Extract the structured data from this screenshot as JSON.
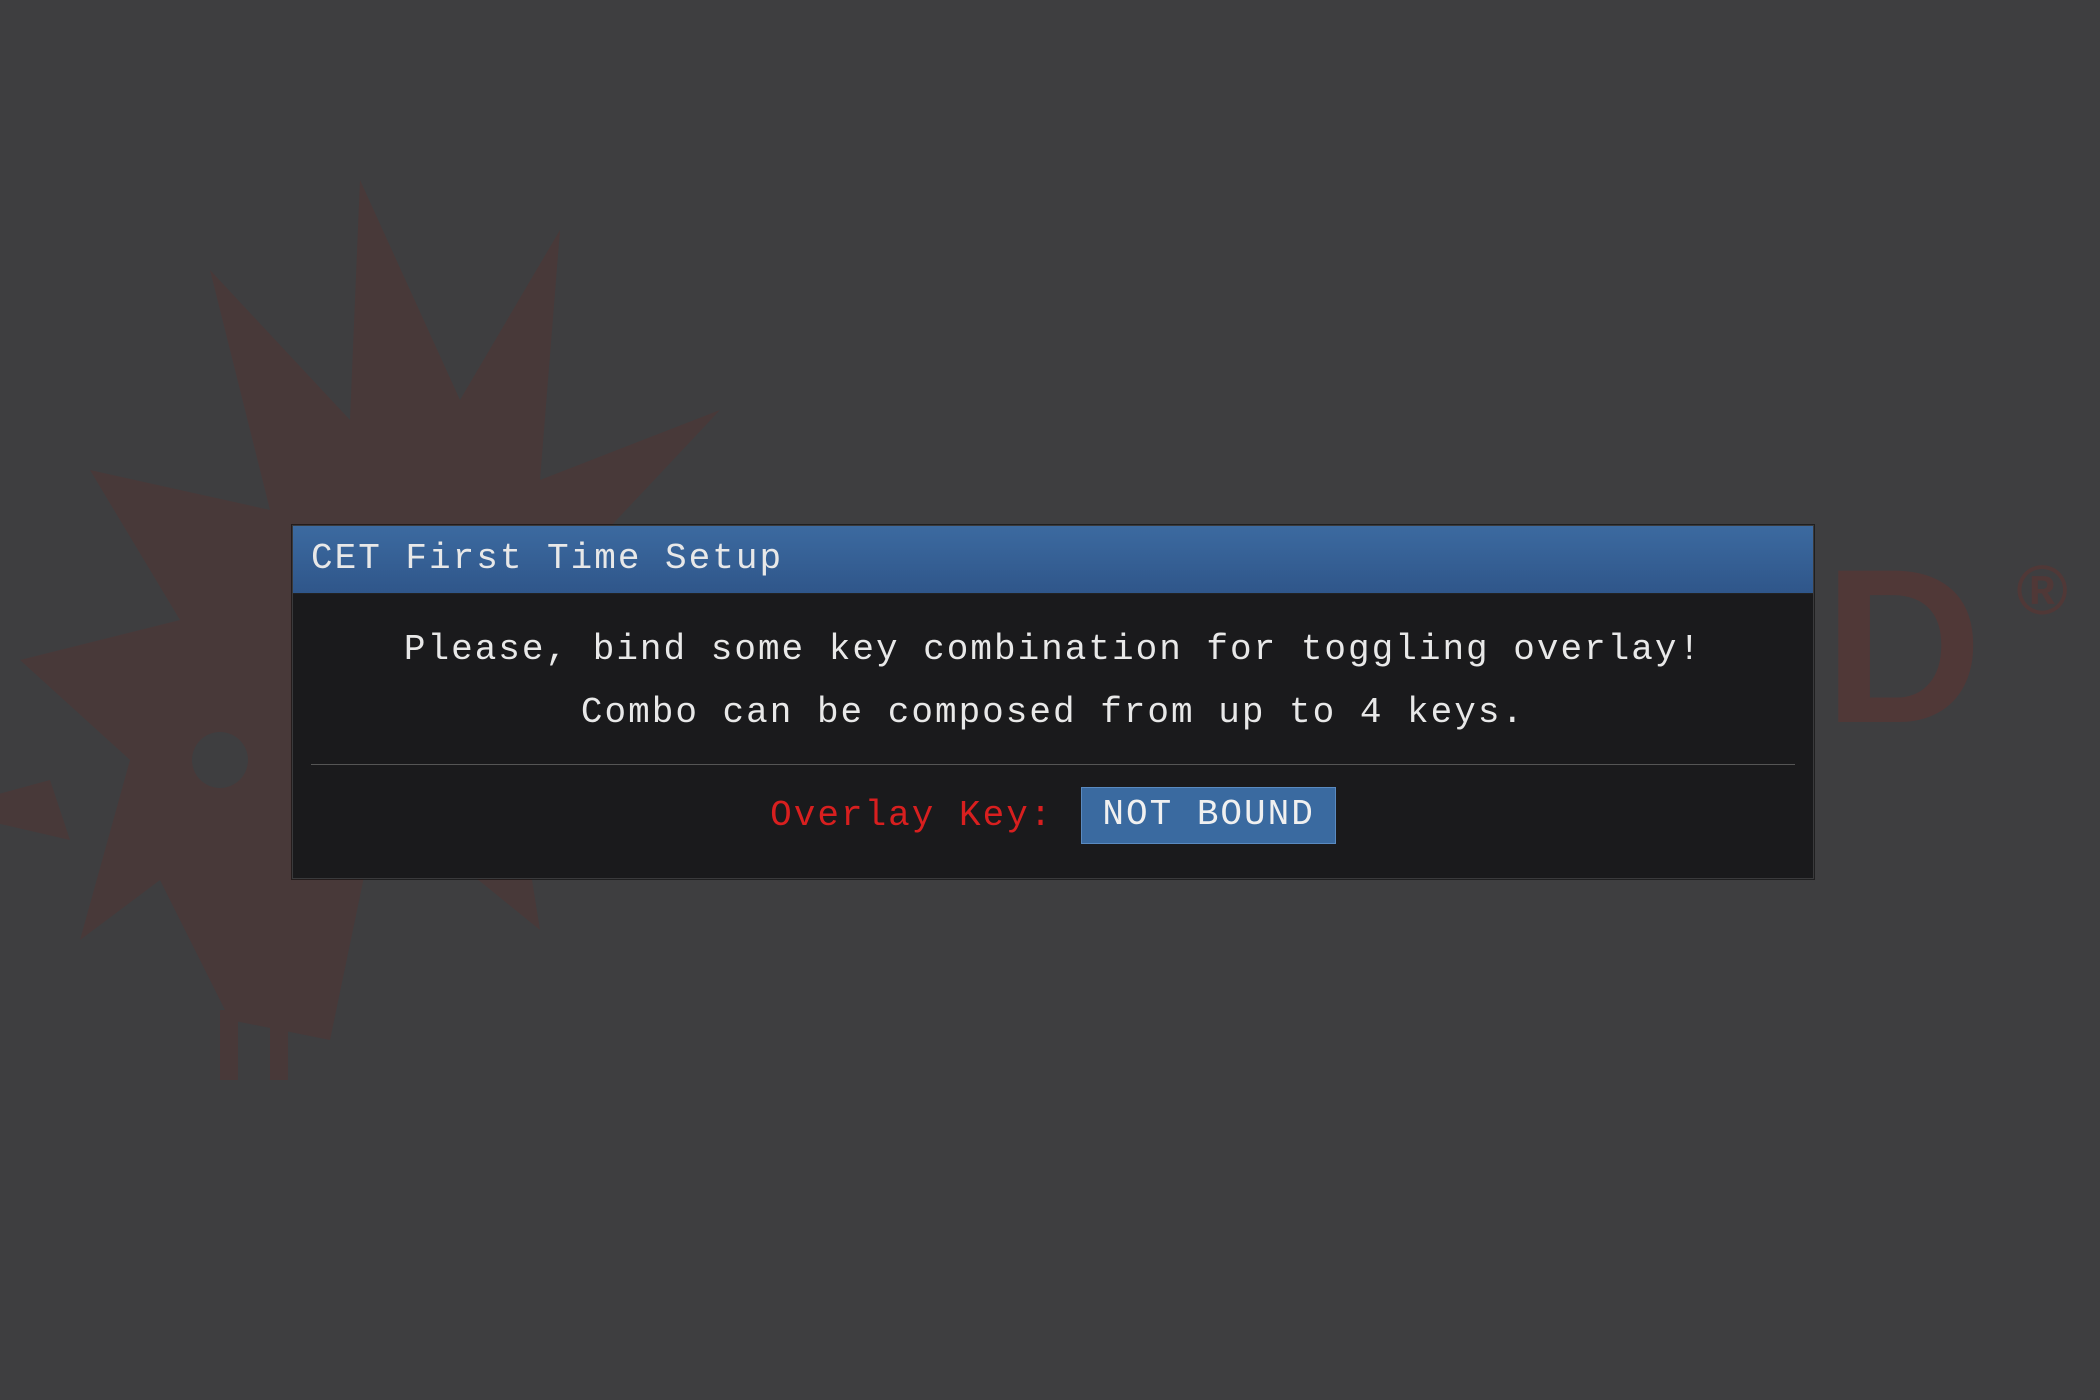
{
  "background": {
    "logo_color": "#7a3c36",
    "visible_text": "ED",
    "trademark": "®"
  },
  "dialog": {
    "title": "CET First Time Setup",
    "instruction_line1": "Please, bind some key combination for toggling overlay!",
    "instruction_line2": "Combo can be composed from up to 4 keys.",
    "bind_label": "Overlay Key:",
    "bind_value": "NOT BOUND"
  },
  "colors": {
    "titlebar": "#365a8a",
    "dialog_bg": "#1a1a1c",
    "label_warn": "#d81f1f",
    "button_bg": "#3a6aa0",
    "text": "#e8e8e8"
  }
}
